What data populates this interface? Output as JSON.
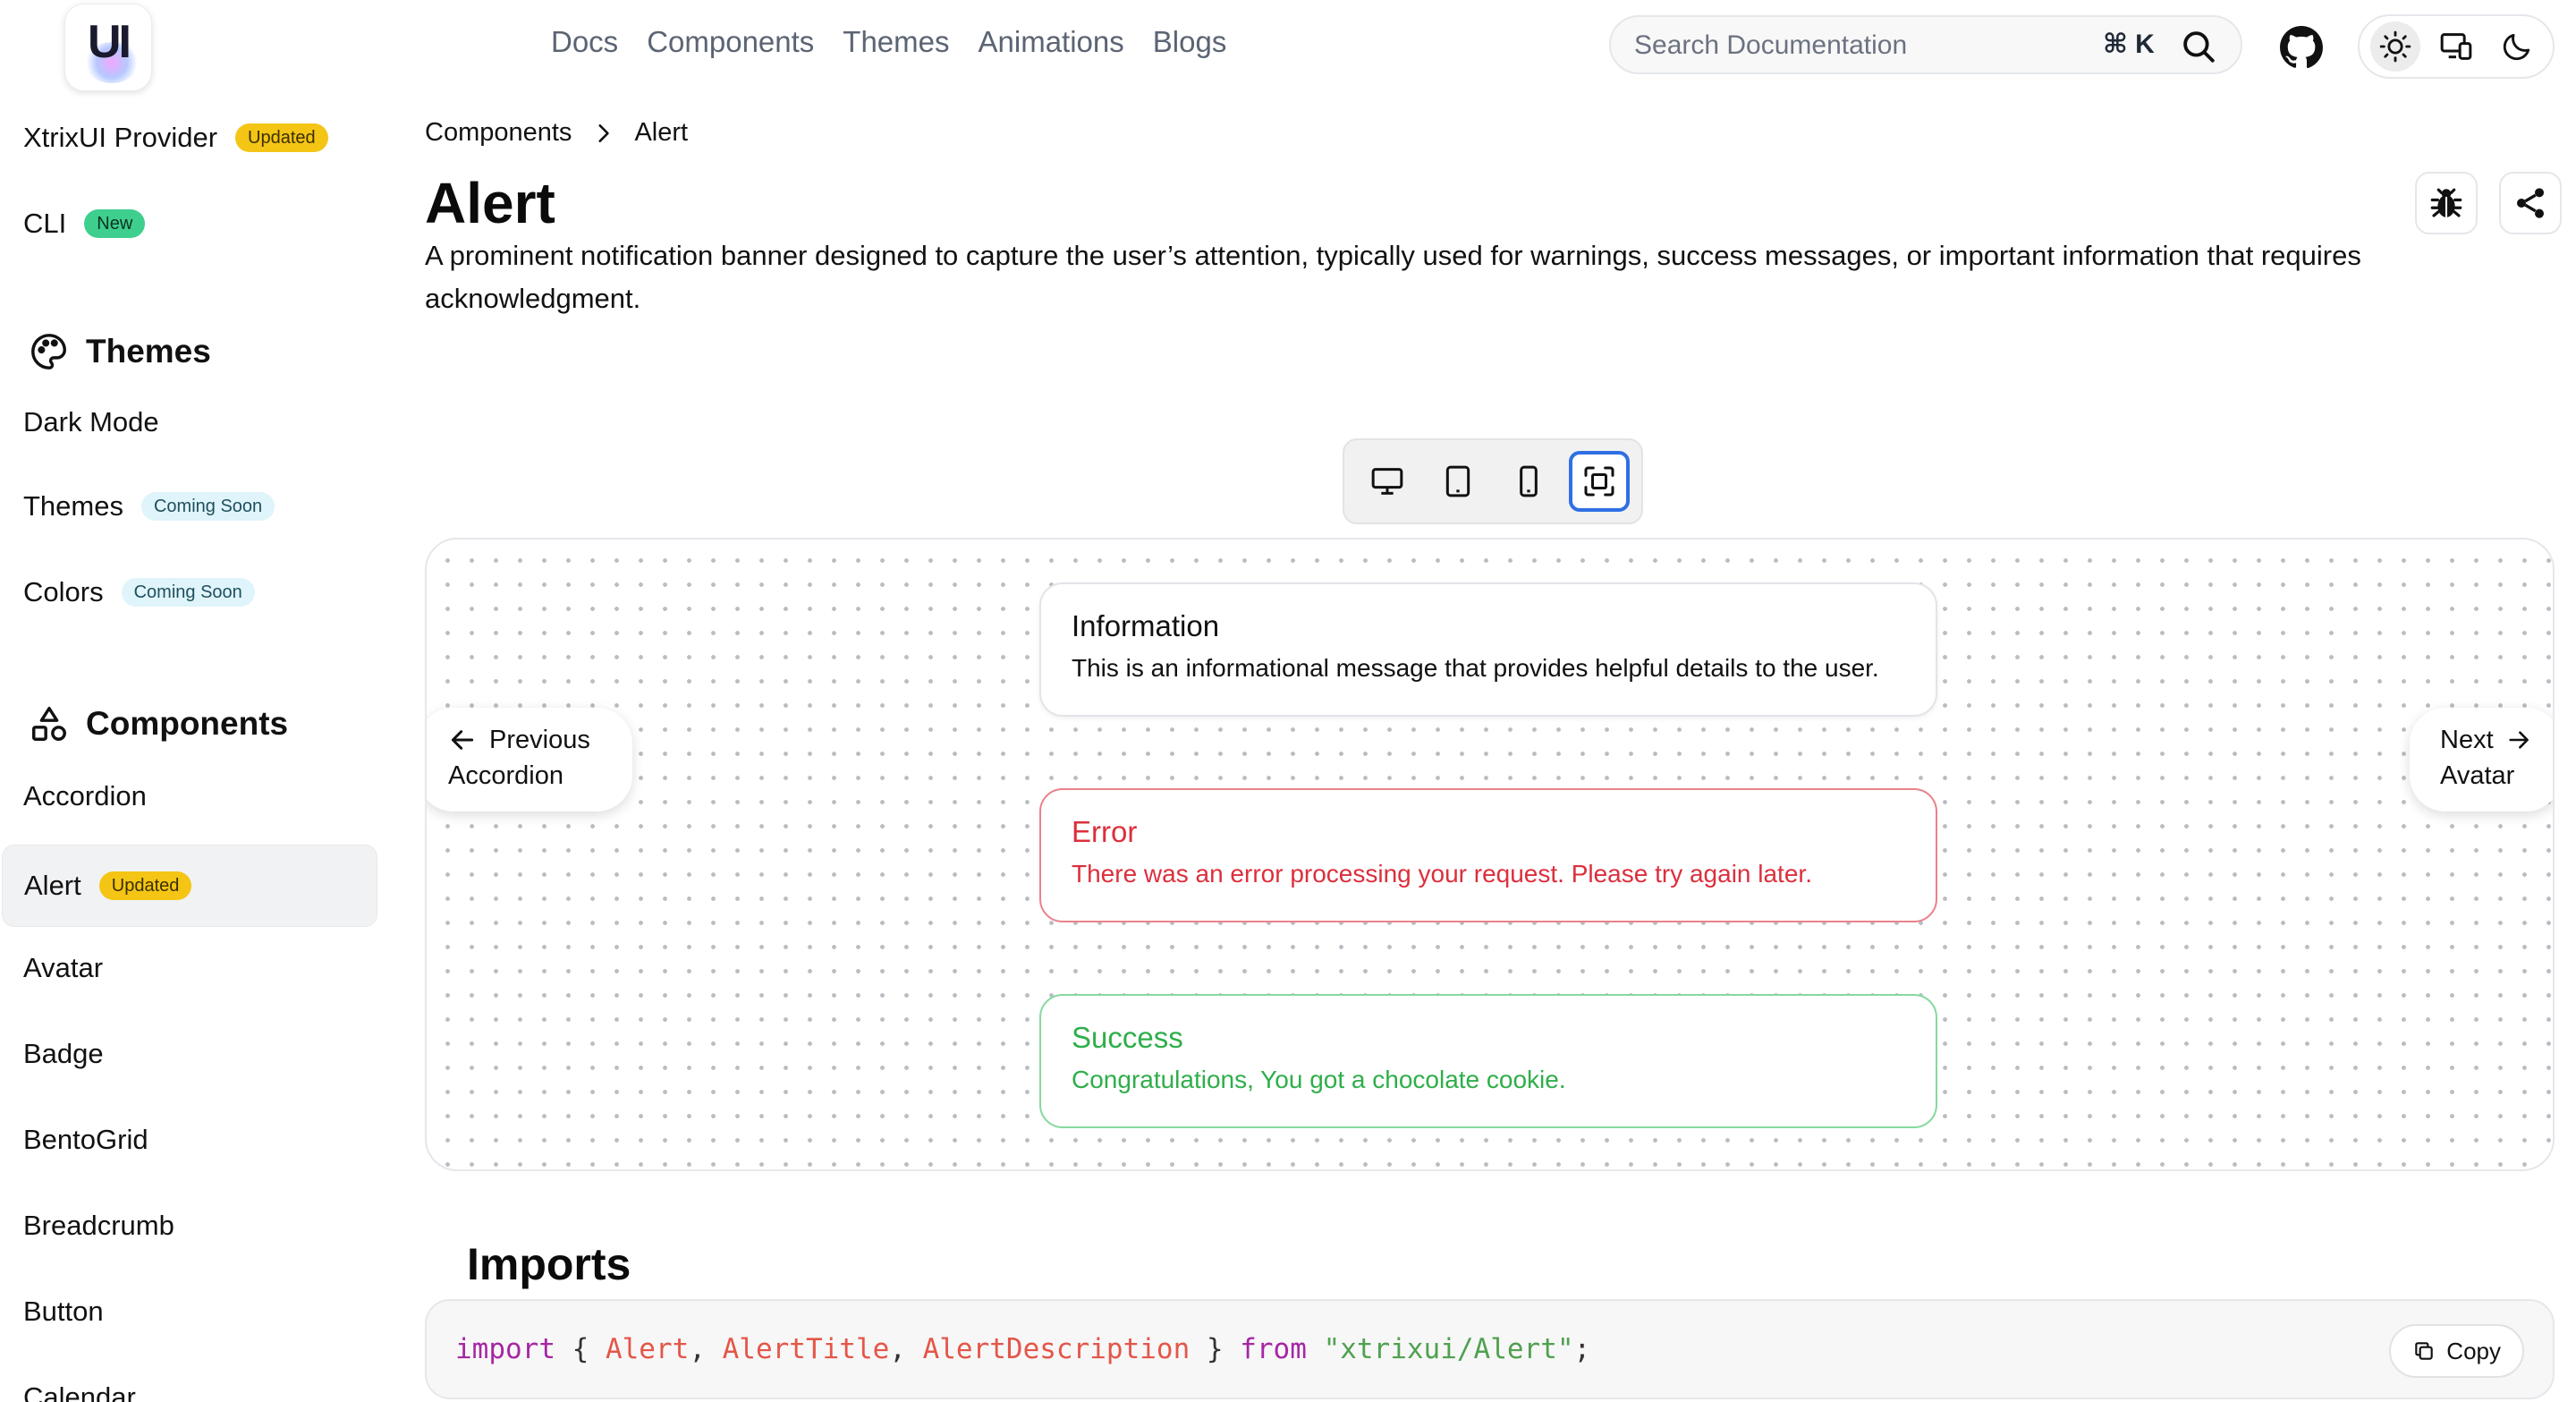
{
  "header": {
    "logo_text": "UI",
    "nav": [
      "Docs",
      "Components",
      "Themes",
      "Animations",
      "Blogs"
    ],
    "search": {
      "placeholder": "Search Documentation",
      "shortcut": "⌘ K"
    }
  },
  "sidebar": {
    "top_items": [
      {
        "label": "XtrixUI Provider",
        "badge": "Updated"
      },
      {
        "label": "CLI",
        "badge": "New"
      }
    ],
    "themes": {
      "heading": "Themes",
      "items": [
        {
          "label": "Dark Mode"
        },
        {
          "label": "Themes",
          "badge": "Coming Soon"
        },
        {
          "label": "Colors",
          "badge": "Coming Soon"
        }
      ]
    },
    "components": {
      "heading": "Components",
      "items": [
        {
          "label": "Accordion"
        },
        {
          "label": "Alert",
          "badge": "Updated",
          "active": true
        },
        {
          "label": "Avatar"
        },
        {
          "label": "Badge"
        },
        {
          "label": "BentoGrid"
        },
        {
          "label": "Breadcrumb"
        },
        {
          "label": "Button"
        },
        {
          "label": "Calendar"
        }
      ]
    }
  },
  "main": {
    "breadcrumb": [
      "Components",
      "Alert"
    ],
    "title": "Alert",
    "description": "A prominent notification banner designed to capture the user’s attention, typically used for warnings, success messages, or important information that requires acknowledgment.",
    "alerts": {
      "info": {
        "title": "Information",
        "description": "This is an informational message that provides helpful details to the user."
      },
      "error": {
        "title": "Error",
        "description": "There was an error processing your request. Please try again later."
      },
      "success": {
        "title": "Success",
        "description": "Congratulations, You got a chocolate cookie."
      }
    },
    "pager": {
      "prev": {
        "label": "Previous",
        "target": "Accordion"
      },
      "next": {
        "label": "Next",
        "target": "Avatar"
      }
    },
    "imports": {
      "heading": "Imports",
      "code": {
        "kw_import": "import",
        "open": " { ",
        "id1": "Alert",
        "comma1": ", ",
        "id2": "AlertTitle",
        "comma2": ", ",
        "id3": "AlertDescription",
        "close": " } ",
        "kw_from": "from",
        "space": " ",
        "module": "\"xtrixui/Alert\"",
        "semi": ";"
      },
      "copy_label": "Copy"
    }
  },
  "colors": {
    "updated_badge": "#f4c515",
    "new_badge": "#3ecf8e",
    "soon_badge": "#dff4fb",
    "error": "#dc2f3d",
    "success": "#2fae4a",
    "active_device": "#2f6fe4"
  },
  "icons": [
    "search-icon",
    "github-icon",
    "sun-icon",
    "devices-icon",
    "moon-icon",
    "palette-icon",
    "shapes-icon",
    "chevron-right-icon",
    "bug-icon",
    "share-icon",
    "monitor-icon",
    "tablet-icon",
    "phone-icon",
    "fullscreen-icon",
    "arrow-left-icon",
    "arrow-right-icon",
    "copy-icon"
  ]
}
